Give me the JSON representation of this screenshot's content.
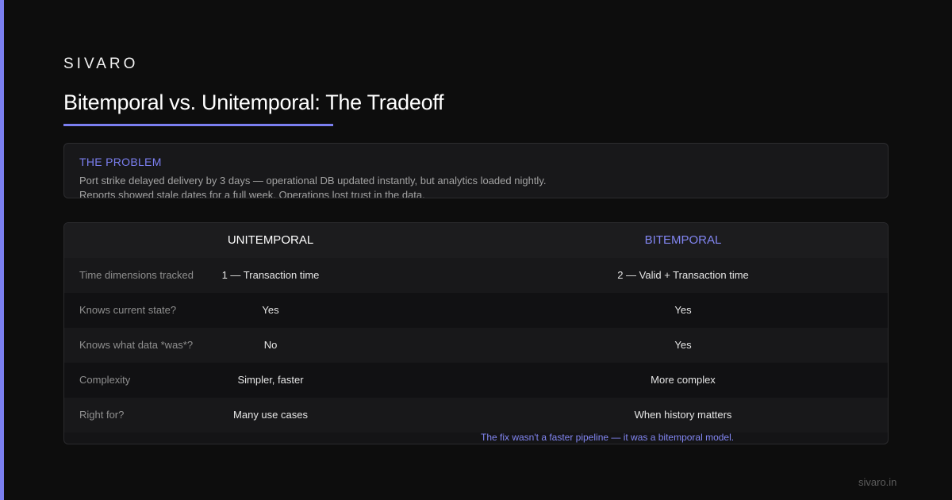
{
  "brand": "SIVARO",
  "title": "Bitemporal vs. Unitemporal: The Tradeoff",
  "problem": {
    "heading": "THE PROBLEM",
    "lines": [
      "Port strike delayed delivery by 3 days — operational DB updated instantly, but analytics loaded nightly.",
      "Reports showed stale dates for a full week. Operations lost trust in the data."
    ]
  },
  "table": {
    "headers": [
      "UNITEMPORAL",
      "BITEMPORAL"
    ],
    "rows": [
      {
        "label": "Time dimensions tracked",
        "uni": "1 — Transaction time",
        "bi": "2 — Valid + Transaction time"
      },
      {
        "label": "Knows current state?",
        "uni": "Yes",
        "bi": "Yes"
      },
      {
        "label": "Knows what data *was*?",
        "uni": "No",
        "bi": "Yes"
      },
      {
        "label": "Complexity",
        "uni": "Simpler, faster",
        "bi": "More complex"
      },
      {
        "label": "Right for?",
        "uni": "Many use cases",
        "bi": "When history matters"
      }
    ]
  },
  "footnote": "The fix wasn't a faster pipeline — it was a bitemporal model.",
  "site": "sivaro.in",
  "colors": {
    "accent": "#7b7ff0",
    "background": "#0d0d0d"
  }
}
